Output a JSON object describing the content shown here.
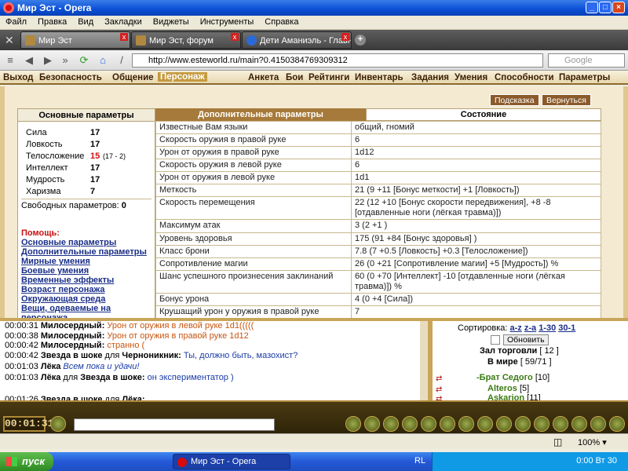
{
  "window": {
    "title": "Мир Эст - Opera"
  },
  "menu": [
    "Файл",
    "Правка",
    "Вид",
    "Закладки",
    "Виджеты",
    "Инструменты",
    "Справка"
  ],
  "tabs": [
    {
      "label": "Мир Эст"
    },
    {
      "label": "Мир Эст, форум"
    },
    {
      "label": "Дети Аманиэль - Главн..."
    }
  ],
  "address": {
    "url": "http://www.esteworld.ru/main?0.4150384769309312",
    "search_placeholder": "Google"
  },
  "gamenav": {
    "left": [
      "Выход",
      "Безопасность",
      "Общение",
      "Персонаж"
    ],
    "right": [
      "Анкета",
      "Бои",
      "Рейтинги",
      "Инвентарь",
      "Задания",
      "Умения",
      "Способности",
      "Параметры"
    ]
  },
  "buttons": {
    "hint": "Подсказка",
    "back": "Вернуться"
  },
  "left": {
    "header": "Основные параметры",
    "stats": [
      {
        "name": "Сила",
        "value": "17"
      },
      {
        "name": "Ловкость",
        "value": "17"
      },
      {
        "name": "Телосложение",
        "value": "15",
        "extra": "(17 - 2)"
      },
      {
        "name": "Интеллект",
        "value": "17"
      },
      {
        "name": "Мудрость",
        "value": "17"
      },
      {
        "name": "Харизма",
        "value": "7"
      }
    ],
    "free_label": "Свободных параметров:",
    "free_value": "0",
    "help_title": "Помощь",
    "help_links": [
      "Основные параметры",
      "Дополнительные параметры",
      "Мирные умения",
      "Боевые умения",
      "Временные эффекты",
      "Возраст персонажа",
      "Окружающая среда",
      "Вещи, одеваемые на персонажа"
    ]
  },
  "mid_header": "Дополнительные параметры",
  "right_header": "Состояние",
  "params": [
    {
      "n": "Известные Вам языки",
      "v": "общий, гномий"
    },
    {
      "n": "Скорость оружия в правой руке",
      "v": "6"
    },
    {
      "n": "Урон от оружия в правой руке",
      "v": "1d12"
    },
    {
      "n": "Скорость оружия в левой руке",
      "v": "6"
    },
    {
      "n": "Урон от оружия в левой руке",
      "v": "1d1"
    },
    {
      "n": "Меткость",
      "v": "21 (9 +11 [Бонус меткости] +1 [Ловкость])"
    },
    {
      "n": "Скорость перемещения",
      "v": "22 (12 +10 [Бонус скорости передвижения], +8 -8 [отдавленные ноги (лёгкая травма)])"
    },
    {
      "n": "Максимум атак",
      "v": "3 (2 +1 )"
    },
    {
      "n": "Уровень здоровья",
      "v": "175 (91 +84 [Бонус здоровья] )"
    },
    {
      "n": "Класс брони",
      "v": "7.8 (7 +0.5 [Ловкость] +0.3 [Телосложение])"
    },
    {
      "n": "Сопротивление магии",
      "v": "26 (0 +21 [Сопротивление магии] +5 [Мудрость]) %"
    },
    {
      "n": "Шанс успешного произнесения заклинаний",
      "v": "60 (0 +70 [Интеллект] -10 [отдавленные ноги (лёгкая травма)]) %"
    },
    {
      "n": "Бонус урона",
      "v": "4 (0 +4 [Сила])"
    },
    {
      "n": "Крушащий урон у оружия в правой руке",
      "v": "7"
    }
  ],
  "chat": [
    {
      "t": "00:00:31",
      "n": "Милосердный:",
      "m": "Урон от оружия в левой руке 1d1(((((",
      "c": "#c8550f"
    },
    {
      "t": "00:00:38",
      "n": "Милосердный:",
      "m": "Урон от оружия в правой руке 1d12",
      "c": "#c8550f"
    },
    {
      "t": "00:00:42",
      "n": "Милосердный:",
      "m": "странно (",
      "c": "#c8550f"
    },
    {
      "t": "00:00:42",
      "n": "Звезда в шоке",
      "mid": "для",
      "n2": "Черноникник:",
      "m": "Ты, должно быть, мазохист?",
      "c": "#1a3ca8"
    },
    {
      "t": "00:01:03",
      "n": "Лёка",
      "m": "Всем пока и удачи!",
      "c": "#1a3ca8",
      "italic": true
    },
    {
      "t": "00:01:03",
      "n": "Лёка",
      "mid": "для",
      "n2": "Звезда в шоке:",
      "m": "он экспериментатор )",
      "c": "#1a3ca8"
    },
    {
      "t": "00:01:26",
      "n": "Звезда в шоке",
      "mid": "для",
      "n2": "Лёка:",
      "m": "",
      "c": "#000"
    }
  ],
  "sidebar": {
    "sort_label": "Сортировка:",
    "sort_links": [
      "a-z",
      "z-a",
      "1-30",
      "30-1"
    ],
    "refresh": "Обновить",
    "hall": "Зал торговли",
    "hall_count": "[ 12 ]",
    "world": "В мире",
    "world_count": "[ 59/71 ]",
    "players": [
      {
        "name": "-Брат Седого",
        "lvl": "[10]"
      },
      {
        "name": "Alteros",
        "lvl": "[5]"
      },
      {
        "name": "Askarion",
        "lvl": "[11]"
      }
    ]
  },
  "clock": "00:01:31",
  "status": {
    "zoom": "100%"
  },
  "taskbar": {
    "start": "пуск",
    "item": "Мир Эст - Opera",
    "lang": "RL",
    "time": "0:00 Вт 30"
  }
}
